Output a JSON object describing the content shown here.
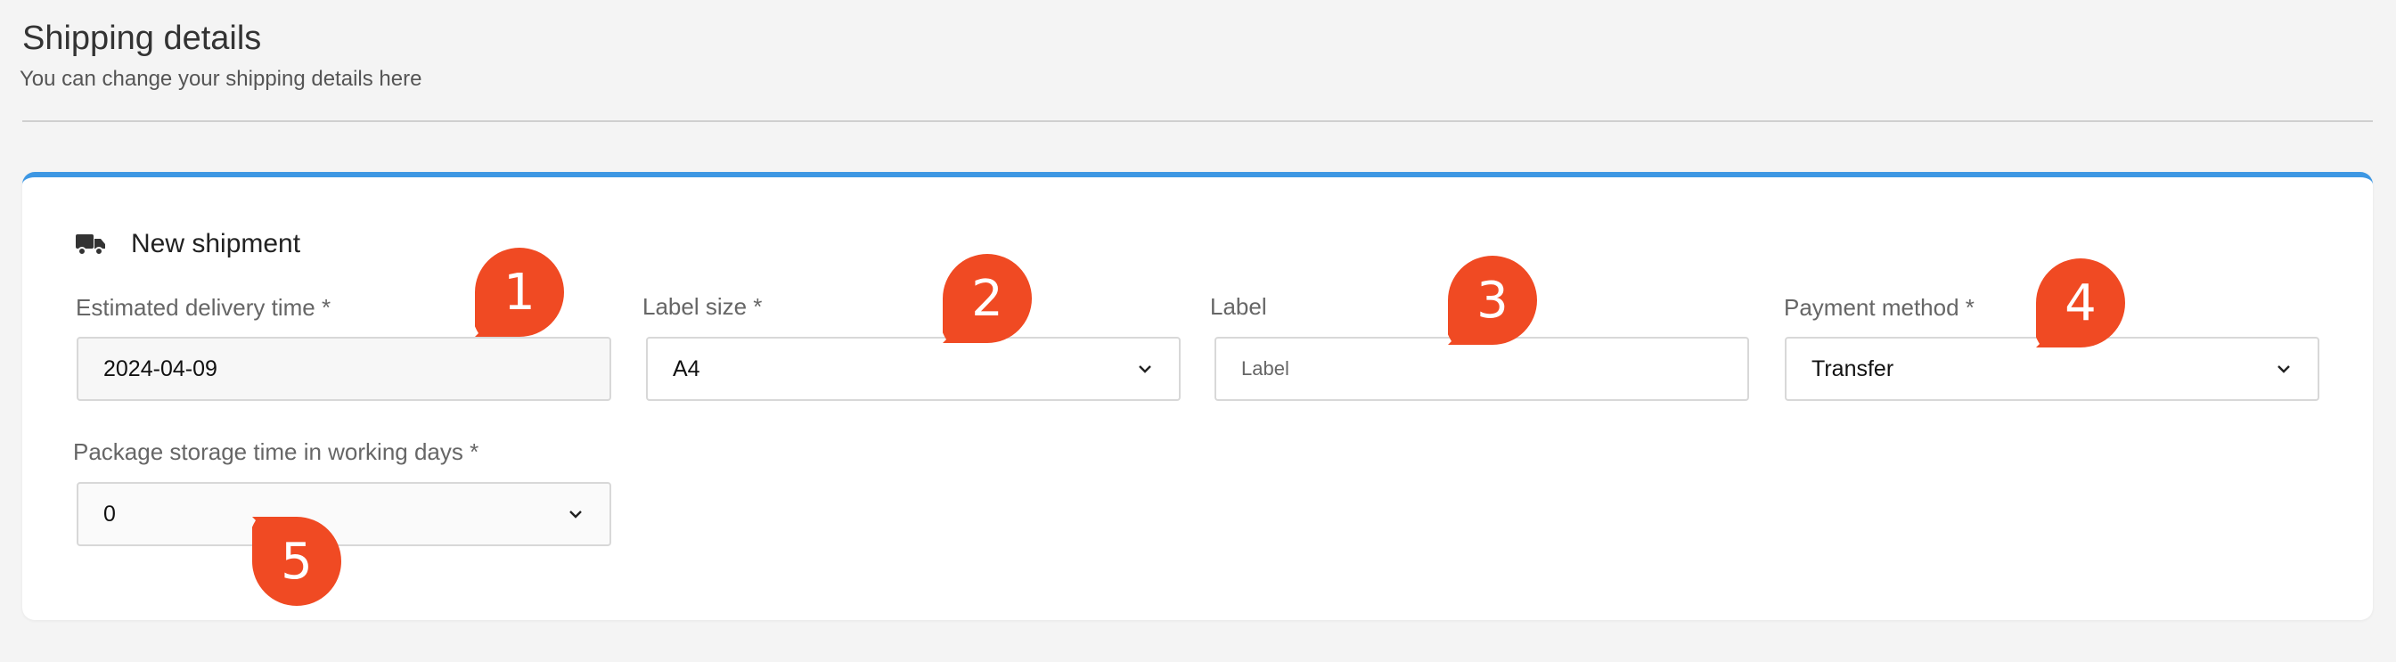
{
  "header": {
    "title": "Shipping details",
    "subtitle": "You can change your shipping details here"
  },
  "card": {
    "title": "New shipment",
    "icon": "truck-icon",
    "accent_color": "#3d97e3"
  },
  "fields": {
    "delivery_time": {
      "label": "Estimated delivery time *",
      "value": "2024-04-09"
    },
    "label_size": {
      "label": "Label size *",
      "value": "A4"
    },
    "label": {
      "label": "Label",
      "placeholder": "Label"
    },
    "payment_method": {
      "label": "Payment method *",
      "value": "Transfer"
    },
    "storage_time": {
      "label": "Package storage time in working days *",
      "value": "0"
    }
  },
  "callouts": {
    "color": "#f04a23",
    "numbers": [
      "1",
      "2",
      "3",
      "4",
      "5"
    ]
  }
}
